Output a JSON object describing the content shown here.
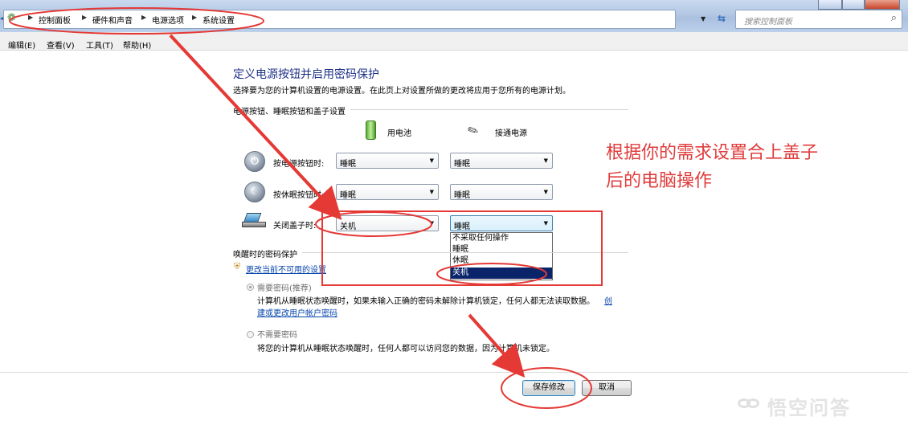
{
  "address_bar": {
    "breadcrumbs": [
      "控制面板",
      "硬件和声音",
      "电源选项",
      "系统设置"
    ],
    "search_placeholder": "搜索控制面板"
  },
  "menu": [
    "编辑(E)",
    "查看(V)",
    "工具(T)",
    "帮助(H)"
  ],
  "page": {
    "title": "定义电源按钮并启用密码保护",
    "description": "选择要为您的计算机设置的电源设置。在此页上对设置所做的更改将应用于您所有的电源计划。",
    "power_section_title": "电源按钮、睡眠按钮和盖子设置",
    "column_battery": "用电池",
    "column_plugged": "接通电源",
    "rows": [
      {
        "label": "按电源按钮时:",
        "battery": "睡眠",
        "plugged": "睡眠",
        "icon": "power-button-icon"
      },
      {
        "label": "按休眠按钮时:",
        "battery": "睡眠",
        "plugged": "睡眠",
        "icon": "sleep-button-icon"
      },
      {
        "label": "关闭盖子时:",
        "battery": "关机",
        "plugged": "睡眠",
        "icon": "laptop-lid-icon"
      }
    ],
    "dropdown_options": [
      "不采取任何操作",
      "睡眠",
      "休眠",
      "关机"
    ],
    "dropdown_selected": "关机",
    "password_section_title": "唤醒时的密码保护",
    "change_settings_link": "更改当前不可用的设置",
    "option_require": "需要密码(推荐)",
    "option_require_desc_1": "计算机从睡眠状态唤醒时，如果未输入正确的密码未解除计算机锁定，任何人都无法读取数据。",
    "option_require_link_a": "创",
    "option_require_link_b": "建或更改用户帐户密码",
    "option_no_password": "不需要密码",
    "option_no_password_desc": "将您的计算机从睡眠状态唤醒时，任何人都可以访问您的数据，因为计算机未锁定。",
    "save_button": "保存修改",
    "cancel_button": "取消"
  },
  "annotation": {
    "line1": "根据你的需求设置合上盖子",
    "line2": "后的电脑操作",
    "color": "#e03c3c"
  },
  "watermark": "悟空问答"
}
